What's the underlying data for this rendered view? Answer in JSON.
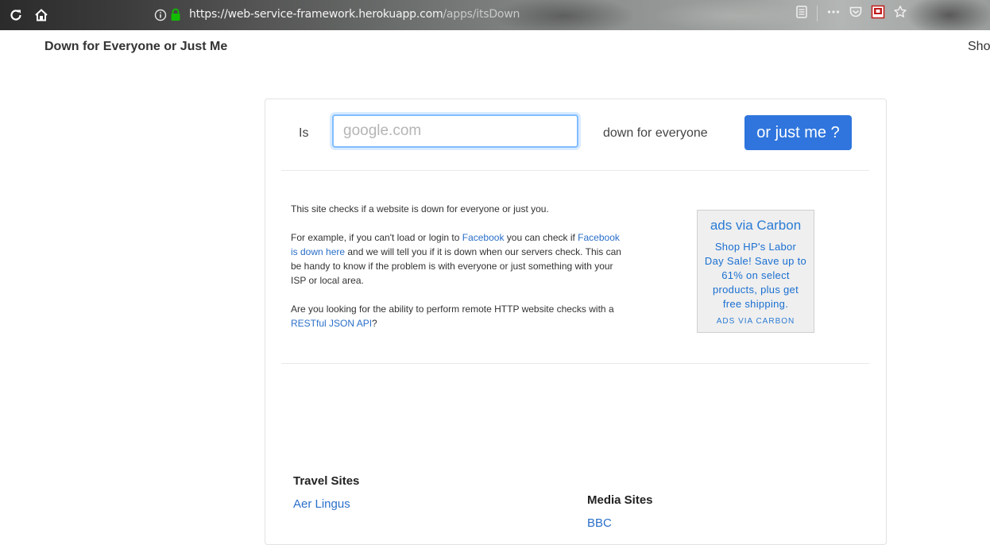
{
  "browser": {
    "url_host": "https://web-service-framework.herokuapp.com",
    "url_path": "/apps/itsDown"
  },
  "header": {
    "brand": "Down for Everyone or Just Me",
    "nav_right": "Sho"
  },
  "check_form": {
    "label_is": "Is",
    "input_placeholder": "google.com",
    "label_down": "down for everyone",
    "button_label": "or just me ?"
  },
  "description": {
    "p1": "This site checks if a website is down for everyone or just you.",
    "p2_before": "For example, if you can't load or login to ",
    "p2_link1": "Facebook",
    "p2_middle": " you can check if ",
    "p2_link2": "Facebook is down here",
    "p2_after": " and we will tell you if it is down when our servers check. This can be handy to know if the problem is with everyone or just something with your ISP or local area.",
    "p3_before": "Are you looking for the ability to perform remote HTTP website checks with a ",
    "p3_link": "RESTful JSON API",
    "p3_after": "?"
  },
  "ad": {
    "title": "ads via Carbon",
    "body": "Shop HP's Labor Day Sale! Save up to 61% on select products, plus get free shipping.",
    "footer": "ADS VIA CARBON"
  },
  "lists": {
    "travel_title": "Travel Sites",
    "travel_first": "Aer Lingus",
    "media_title": "Media Sites",
    "media_first": "BBC"
  },
  "colors": {
    "accent": "#2f75dd",
    "link": "#2a6fc9",
    "lock_green": "#12bc00"
  }
}
